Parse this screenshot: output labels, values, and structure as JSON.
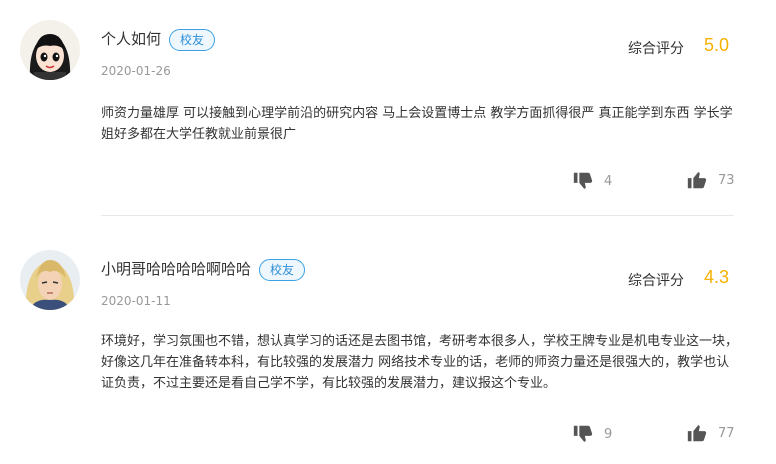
{
  "reviews": [
    {
      "name": "个人如何",
      "badge": "校友",
      "date": "2020-01-26",
      "score_label": "综合评分",
      "score": "5.0",
      "content": "师资力量雄厚 可以接触到心理学前沿的研究内容 马上会设置博士点 教学方面抓得很严 真正能学到东西 学长学姐好多都在大学任教就业前景很广",
      "dislikes": "4",
      "likes": "73"
    },
    {
      "name": "小明哥哈哈哈哈啊哈哈",
      "badge": "校友",
      "date": "2020-01-11",
      "score_label": "综合评分",
      "score": "4.3",
      "content": "环境好，学习氛围也不错，想认真学习的话还是去图书馆，考研考本很多人，学校王牌专业是机电专业这一块，好像这几年在准备转本科，有比较强的发展潜力 网络技术专业的话，老师的师资力量还是很强大的，教学也认证负责，不过主要还是看自己学不学，有比较强的发展潜力，建议报这个专业。",
      "dislikes": "9",
      "likes": "77"
    }
  ],
  "icons": {
    "dislike": "thumbs-down-icon",
    "like": "thumbs-up-icon"
  },
  "colors": {
    "score": "#f7b100",
    "badge": "#3aa2e3"
  }
}
